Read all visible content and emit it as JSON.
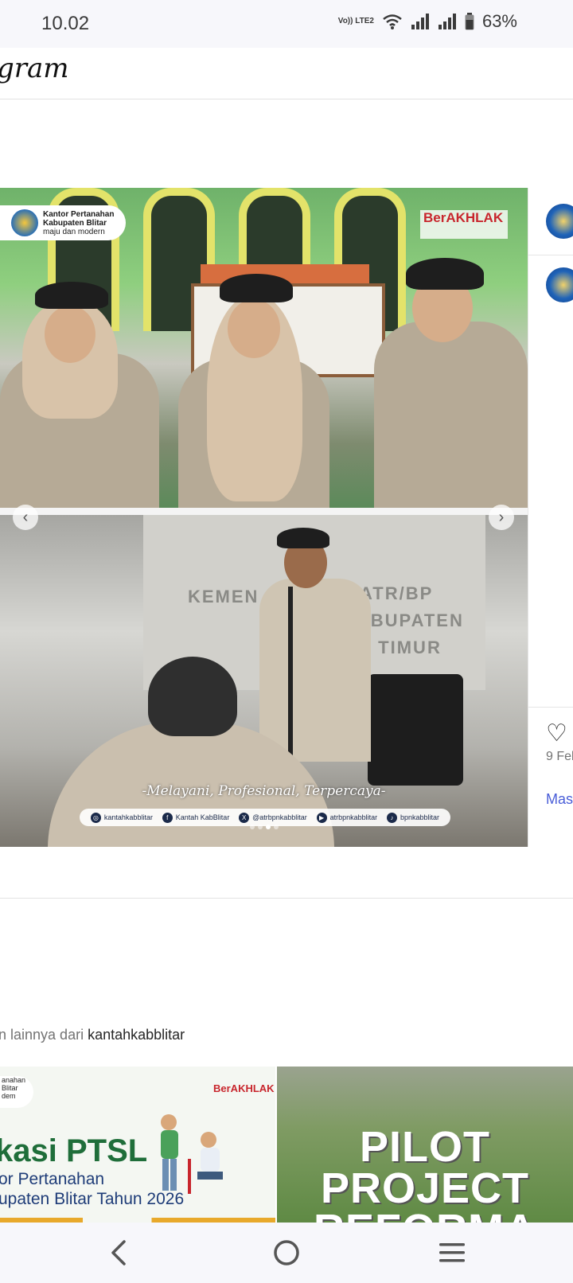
{
  "status_bar": {
    "time": "10.02",
    "volte_label": "Vo)) LTE2",
    "battery": "63%"
  },
  "topbar": {
    "logo_fragment": "gram"
  },
  "post": {
    "media_top": {
      "badge_title": "Kantor Pertanahan",
      "badge_subtitle": "Kabupaten Blitar",
      "badge_motto": "maju dan modern",
      "berakhlak": "BerAKHLAK"
    },
    "media_bottom": {
      "wall_text_1": "KEMEN",
      "wall_text_2": "ATR/BP",
      "wall_text_3": "KABUPATEN",
      "wall_text_4": "A TIMUR",
      "tagline": "-Melayani, Profesional, Terpercaya-",
      "socials": [
        {
          "icon": "instagram-icon",
          "glyph": "◎",
          "label": "kantahkabblitar"
        },
        {
          "icon": "facebook-icon",
          "glyph": "f",
          "label": "Kantah KabBlitar"
        },
        {
          "icon": "x-icon",
          "glyph": "X",
          "label": "@atrbpnkabblitar"
        },
        {
          "icon": "youtube-icon",
          "glyph": "▶",
          "label": "atrbpnkabblitar"
        },
        {
          "icon": "tiktok-icon",
          "glyph": "♪",
          "label": "bpnkabblitar"
        }
      ]
    },
    "carousel": {
      "prev": "‹",
      "next": "›",
      "slide_count": 4,
      "active_slide": 2
    },
    "side": {
      "heart": "♡",
      "date_fragment": "9 Feb",
      "more_fragment": "Mas"
    }
  },
  "more_from": {
    "prefix": "n lainnya dari ",
    "username": "kantahkabblitar"
  },
  "grid": {
    "left": {
      "badge": "anahan\nBlitar\ndem",
      "right_badge": "BerAKHLAK",
      "title": "kasi PTSL",
      "sub1": "or Pertanahan",
      "sub2": "upaten Blitar Tahun 2026"
    },
    "right": {
      "line1": "PILOT",
      "line2": "PROJECT",
      "line3": "REFORMA"
    }
  },
  "sysnav": {
    "back": "back-icon",
    "home": "home-icon",
    "recents": "recents-icon"
  },
  "colors": {
    "accent_link": "#4a5ed8",
    "brand_red": "#c8262d"
  }
}
